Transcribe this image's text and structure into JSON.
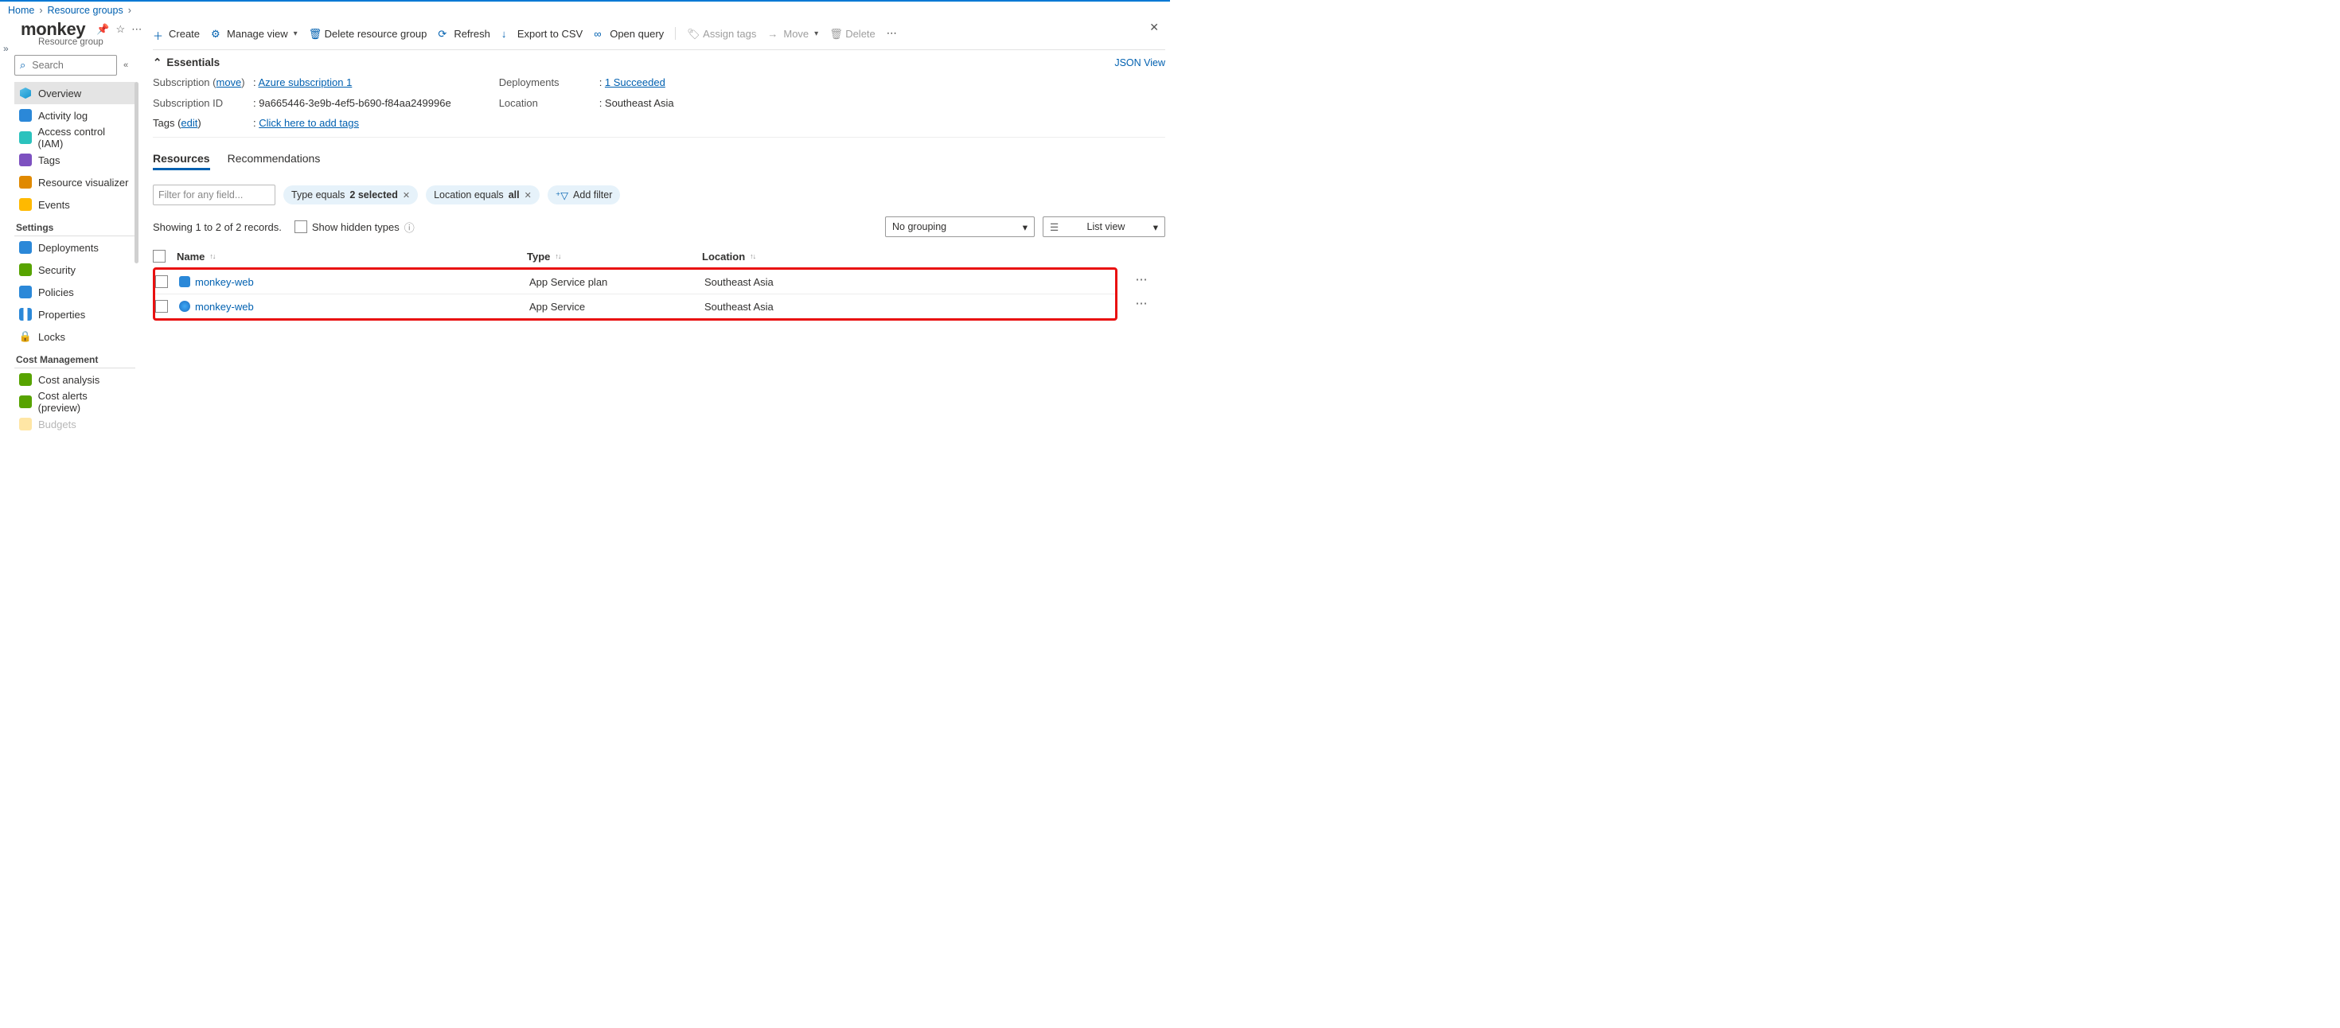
{
  "breadcrumbs": {
    "home": "Home",
    "rg": "Resource groups"
  },
  "header": {
    "title": "monkey",
    "subtype": "Resource group"
  },
  "search": {
    "placeholder": "Search"
  },
  "nav": {
    "items": [
      {
        "label": "Overview"
      },
      {
        "label": "Activity log"
      },
      {
        "label": "Access control (IAM)"
      },
      {
        "label": "Tags"
      },
      {
        "label": "Resource visualizer"
      },
      {
        "label": "Events"
      }
    ],
    "section_settings": "Settings",
    "settings": [
      {
        "label": "Deployments"
      },
      {
        "label": "Security"
      },
      {
        "label": "Policies"
      },
      {
        "label": "Properties"
      },
      {
        "label": "Locks"
      }
    ],
    "section_cost": "Cost Management",
    "cost": [
      {
        "label": "Cost analysis"
      },
      {
        "label": "Cost alerts (preview)"
      },
      {
        "label": "Budgets"
      }
    ]
  },
  "commands": {
    "create": "Create",
    "manage_view": "Manage view",
    "delete_rg": "Delete resource group",
    "refresh": "Refresh",
    "export_csv": "Export to CSV",
    "open_query": "Open query",
    "assign_tags": "Assign tags",
    "move": "Move",
    "delete": "Delete"
  },
  "essentials": {
    "title": "Essentials",
    "json_view": "JSON View",
    "sub_label": "Subscription",
    "sub_move": "move",
    "sub_value": "Azure subscription 1",
    "subid_label": "Subscription ID",
    "subid_value": "9a665446-3e9b-4ef5-b690-f84aa249996e",
    "deploy_label": "Deployments",
    "deploy_value": "1 Succeeded",
    "loc_label": "Location",
    "loc_value": "Southeast Asia",
    "tags_label": "Tags",
    "tags_edit": "edit",
    "tags_value": "Click here to add tags"
  },
  "tabs": {
    "resources": "Resources",
    "recommendations": "Recommendations"
  },
  "filters": {
    "filter_placeholder": "Filter for any field...",
    "pill_type": {
      "prefix": "Type equals ",
      "bold": "2 selected"
    },
    "pill_loc": {
      "prefix": "Location equals ",
      "bold": "all"
    },
    "add_filter": "Add filter"
  },
  "records": {
    "summary": "Showing 1 to 2 of 2 records.",
    "show_hidden": "Show hidden types",
    "grouping": "No grouping",
    "view": "List view"
  },
  "table": {
    "col_name": "Name",
    "col_type": "Type",
    "col_loc": "Location",
    "rows": [
      {
        "name": "monkey-web",
        "type": "App Service plan",
        "loc": "Southeast Asia",
        "icon": "plan"
      },
      {
        "name": "monkey-web",
        "type": "App Service",
        "loc": "Southeast Asia",
        "icon": "app"
      }
    ]
  }
}
